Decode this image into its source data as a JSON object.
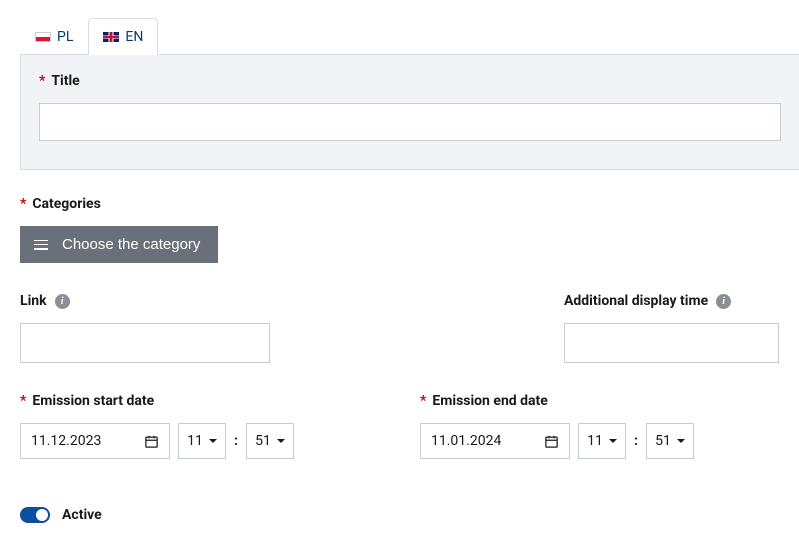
{
  "tabs": {
    "pl": "PL",
    "en": "EN"
  },
  "title": {
    "label": "Title",
    "value": ""
  },
  "categories": {
    "label": "Categories",
    "button": "Choose the category"
  },
  "link": {
    "label": "Link",
    "value": ""
  },
  "additional_display_time": {
    "label": "Additional display time",
    "value": ""
  },
  "emission_start": {
    "label": "Emission start date",
    "date": "11.12.2023",
    "hour": "11",
    "sep": ":",
    "minute": "51"
  },
  "emission_end": {
    "label": "Emission end date",
    "date": "11.01.2024",
    "hour": "11",
    "sep": ":",
    "minute": "51"
  },
  "active": {
    "label": "Active",
    "on": true
  }
}
